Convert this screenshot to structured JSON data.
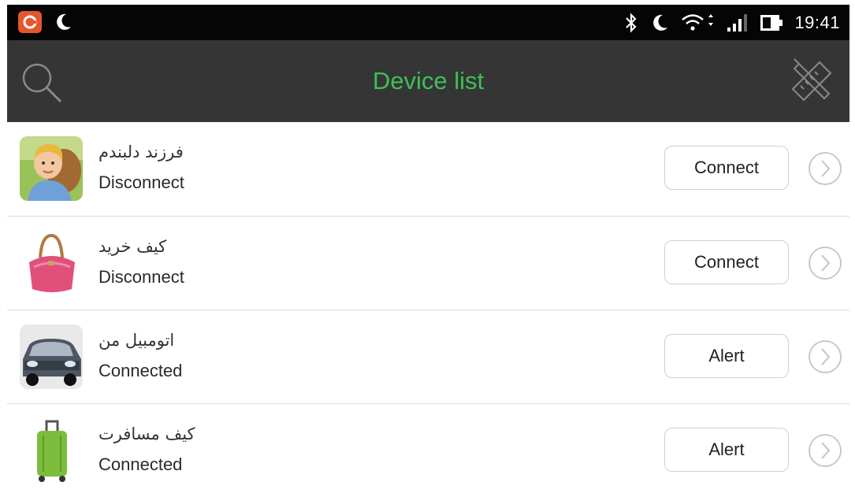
{
  "statusbar": {
    "time": "19:41",
    "icons": [
      "app-badge-icon",
      "moon-icon",
      "bluetooth-icon",
      "moon-icon",
      "wifi-icon",
      "signal-icon",
      "battery-icon"
    ]
  },
  "appbar": {
    "title": "Device list",
    "left_icon": "search-icon",
    "right_icon": "tools-icon",
    "title_color": "#3fbf56",
    "background": "#353535"
  },
  "devices": [
    {
      "name": "فرزند دلبندم",
      "status": "Disconnect",
      "action": "Connect",
      "image": "child-photo"
    },
    {
      "name": "کیف خرید",
      "status": "Disconnect",
      "action": "Connect",
      "image": "handbag-photo"
    },
    {
      "name": "اتومبیل من",
      "status": "Connected",
      "action": "Alert",
      "image": "car-photo"
    },
    {
      "name": "کیف مسافرت",
      "status": "Connected",
      "action": "Alert",
      "image": "suitcase-photo"
    }
  ]
}
